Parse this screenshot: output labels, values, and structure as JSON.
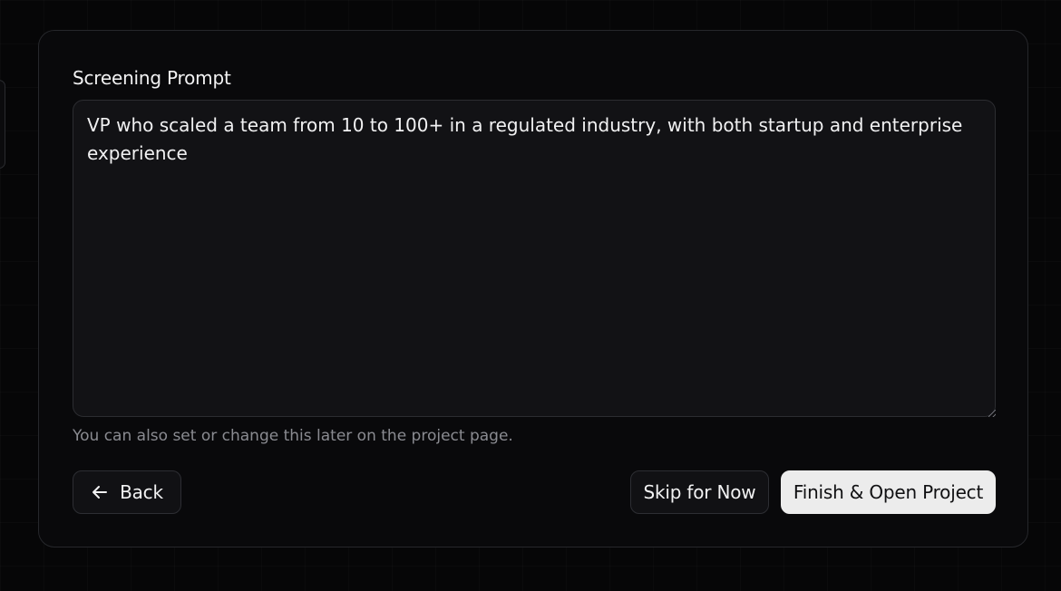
{
  "form": {
    "label": "Screening Prompt",
    "prompt_value": "VP who scaled a team from 10 to 100+ in a regulated industry, with both startup and enterprise experience",
    "helper_text": "You can also set or change this later on the project page."
  },
  "actions": {
    "back_label": "Back",
    "back_icon": "arrow-left-icon",
    "skip_label": "Skip for Now",
    "finish_label": "Finish & Open Project"
  },
  "colors": {
    "background": "#060607",
    "card": "#09090b",
    "primary_button": "#ececec",
    "text": "#f2f2f3",
    "muted_text": "#8a8b91"
  }
}
